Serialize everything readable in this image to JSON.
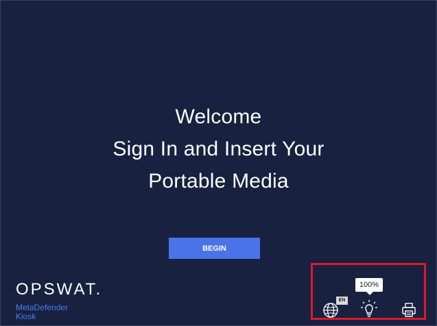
{
  "welcome": {
    "line1": "Welcome",
    "line2": "Sign In and Insert Your",
    "line3": "Portable Media"
  },
  "begin_button": {
    "label": "BEGIN",
    "color": "#4a73e8"
  },
  "brand": {
    "logo": "OPSWAT.",
    "product_line1": "MetaDefender",
    "product_line2": "Kiosk"
  },
  "toolbar": {
    "brightness_tooltip": "100%",
    "language_badge": "EN",
    "icons": [
      "globe-icon",
      "lightbulb-icon",
      "printer-icon"
    ]
  },
  "colors": {
    "background": "#182140",
    "accent": "#4a73e8",
    "highlight": "#e0182a"
  }
}
